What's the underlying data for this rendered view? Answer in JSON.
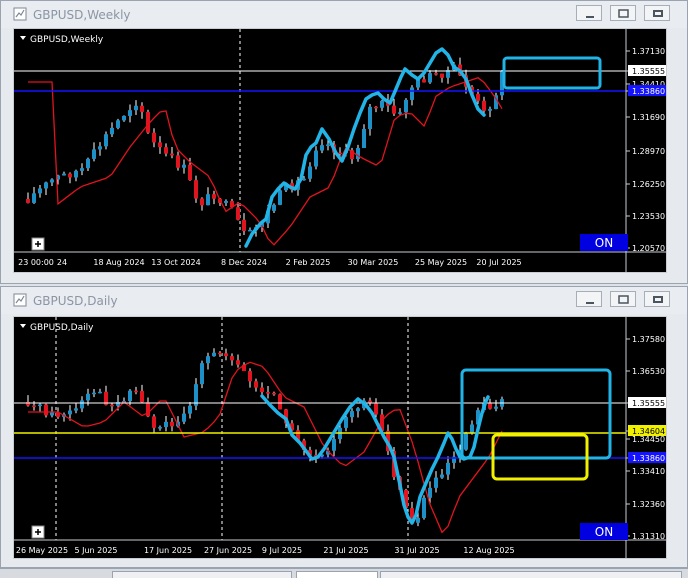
{
  "windows": [
    {
      "window_title": "GBPUSD,Weekly",
      "chart_label": "GBPUSD,Weekly",
      "on_label": "ON",
      "x_labels": [
        "23 00:00",
        "24",
        "18 Aug 2024",
        "13 Oct 2024",
        "8 Dec 2024",
        "2 Feb 2025",
        "30 Mar 2025",
        "25 May 2025",
        "20 Jul 2025"
      ],
      "price_labels": [
        "1.37130",
        "1.35555",
        "1.34410",
        "1.33860",
        "1.31690",
        "1.28970",
        "1.26250",
        "1.23530",
        "1.20570"
      ]
    },
    {
      "window_title": "GBPUSD,Daily",
      "chart_label": "GBPUSD,Daily",
      "on_label": "ON",
      "x_labels": [
        "26 May 2025",
        "5 Jun 2025",
        "17 Jun 2025",
        "27 Jun 2025",
        "9 Jul 2025",
        "21 Jul 2025",
        "31 Jul 2025",
        "12 Aug 2025"
      ],
      "price_labels": [
        "1.37580",
        "1.36530",
        "1.35555",
        "1.34604",
        "1.34450",
        "1.33860",
        "1.33410",
        "1.32360",
        "1.31310"
      ]
    }
  ],
  "colors": {
    "bull": "#1e90c8",
    "bear": "#e0141e",
    "ma": "#e0141e",
    "drawn_line": "#22b4e6",
    "blue_level": "#1414ff",
    "yellow_level": "#f0f000",
    "white_level": "#ffffff",
    "on_button": "#0000e0"
  },
  "icons": [
    "chart-window-icon",
    "minimize-icon",
    "restore-icon",
    "close-icon",
    "plus-icon"
  ]
}
